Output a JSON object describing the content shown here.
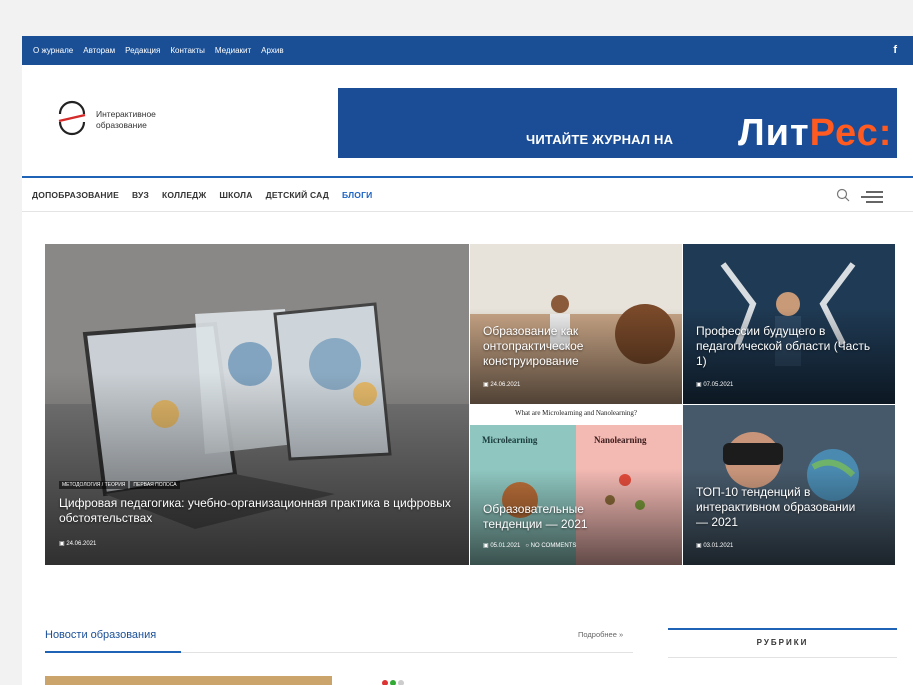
{
  "topbar": {
    "links": [
      "О журнале",
      "Авторам",
      "Редакция",
      "Контакты",
      "Медиакит",
      "Архив"
    ],
    "social": "f"
  },
  "logo": {
    "line1": "Интерактивное",
    "line2": "образование"
  },
  "banner": {
    "text": "ЧИТАЙТЕ ЖУРНАЛ НА",
    "brand_part1": "Лит",
    "brand_part2": "Рес:"
  },
  "nav": {
    "items": [
      "ДОПОБРАЗОВАНИЕ",
      "ВУЗ",
      "КОЛЛЕДЖ",
      "ШКОЛА",
      "ДЕТСКИЙ САД",
      "БЛОГИ"
    ],
    "active": "БЛОГИ"
  },
  "hero": {
    "main": {
      "categories": [
        "МЕТОДОЛОГИЯ / ТЕОРИЯ",
        "ПЕРВАЯ ПОЛОСА"
      ],
      "title": "Цифровая педагогика: учебно-организационная практика в цифровых обстоятельствах",
      "date": "24.06.2021"
    },
    "tiles": [
      {
        "title": "Образование как онтопрактическое конструирование",
        "date": "24.06.2021"
      },
      {
        "title": "Профессии будущего в педагогической области (Часть 1)",
        "date": "07.05.2021"
      },
      {
        "title": "Образовательные тенденции — 2021",
        "date": "05.01.2021",
        "comments": "NO COMMENTS",
        "img_header": "What are Microlearning and Nanolearning?",
        "img_left": "Microlearning",
        "img_right": "Nanolearning"
      },
      {
        "title": "ТОП-10 тенденций в интерактивном образовании — 2021",
        "date": "03.01.2021"
      }
    ]
  },
  "news": {
    "title": "Новости образования",
    "more": "Подробнее »"
  },
  "sidebar": {
    "title": "РУБРИКИ"
  },
  "colors": {
    "brand_blue": "#1a4f96",
    "accent_orange": "#ff5a1f"
  }
}
